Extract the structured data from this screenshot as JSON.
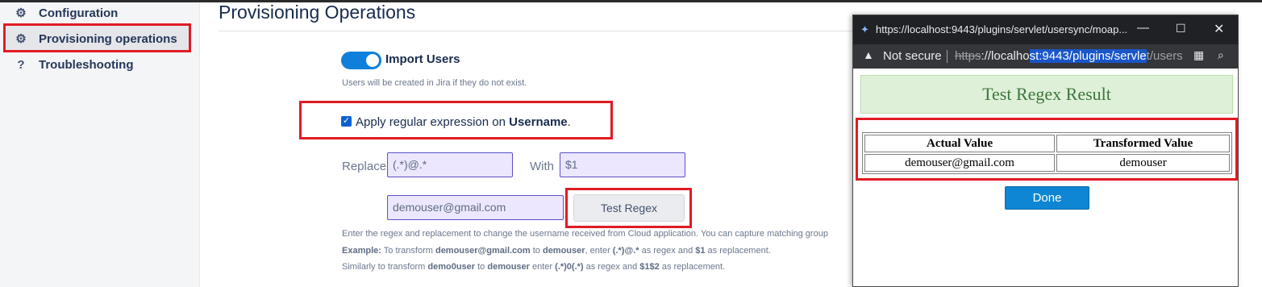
{
  "sidebar": {
    "items": [
      {
        "label": "Configuration",
        "icon": "gear-icon",
        "glyph": "⚙"
      },
      {
        "label": "Provisioning operations",
        "icon": "gear-icon",
        "glyph": "⚙"
      },
      {
        "label": "Troubleshooting",
        "icon": "question-icon",
        "glyph": "?"
      }
    ]
  },
  "main": {
    "title": "Provisioning Operations",
    "import_users": {
      "label": "Import Users",
      "enabled": true,
      "hint": "Users will be created in Jira if they do not exist."
    },
    "regex_checkbox": {
      "checked": true,
      "label_prefix": "Apply regular expression on ",
      "label_bold": "Username",
      "label_suffix": "."
    },
    "replace": {
      "label": "Replace",
      "value": "(.*)@.*"
    },
    "with": {
      "label": "With",
      "value": "$1"
    },
    "test_input": {
      "value": "demouser@gmail.com"
    },
    "test_button": "Test Regex",
    "help": {
      "line1": "Enter the regex and replacement to change the username received from Cloud application. You can capture matching group",
      "example_label": "Example:",
      "line2_a": " To transform ",
      "line2_b": "demouser@gmail.com",
      "line2_c": " to ",
      "line2_d": "demouser",
      "line2_e": ", enter ",
      "line2_f": "(.*)@.*",
      "line2_g": " as regex and ",
      "line2_h": "$1",
      "line2_i": " as replacement.",
      "line3_a": "Similarly to transform ",
      "line3_b": "demo0user",
      "line3_c": " to ",
      "line3_d": "demouser",
      "line3_e": " enter ",
      "line3_f": "(.*)0(.*)",
      "line3_g": " as regex and ",
      "line3_h": "$1$2",
      "line3_i": " as replacement."
    }
  },
  "popup": {
    "window_title": "https://localhost:9443/plugins/servlet/usersync/moap...",
    "not_secure": "Not secure",
    "address": {
      "scheme": "https",
      "host_plain": "://localho",
      "selected": "st:9443/plugins/servle",
      "rest": "t/users"
    },
    "banner": "Test Regex Result",
    "table": {
      "headers": [
        "Actual Value",
        "Transformed Value"
      ],
      "row": [
        "demouser@gmail.com",
        "demouser"
      ]
    },
    "done": "Done"
  },
  "colors": {
    "accent": "#0f7fdb",
    "highlight_border": "#e01b24",
    "banner_bg": "#dff0d8"
  }
}
